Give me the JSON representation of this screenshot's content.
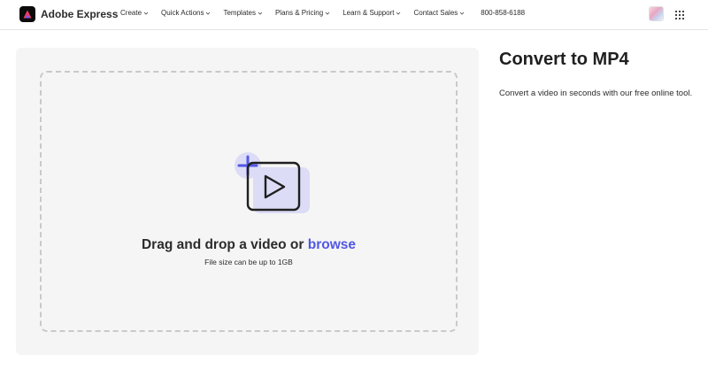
{
  "brand": {
    "name": "Adobe Express",
    "logo_icon": "adobe-express-logo-icon"
  },
  "nav": {
    "items": [
      {
        "label": "Create"
      },
      {
        "label": "Quick Actions"
      },
      {
        "label": "Templates"
      },
      {
        "label": "Plans & Pricing"
      },
      {
        "label": "Learn & Support"
      },
      {
        "label": "Contact Sales"
      }
    ],
    "phone": "800-858-6188",
    "chevron_icon": "chevron-down-icon",
    "apps_icon": "apps-grid-icon"
  },
  "upload": {
    "heading_prefix": "Drag and drop a video or ",
    "browse_label": "browse",
    "subtext": "File size can be up to 1GB",
    "icon": "add-video-icon"
  },
  "panel": {
    "title": "Convert to MP4",
    "description": "Convert a video in seconds with our free online tool."
  },
  "colors": {
    "accent": "#5258e4",
    "card_bg": "#f5f5f5",
    "dash": "#c9c9c9",
    "icon_tint": "#dcdcf7"
  }
}
